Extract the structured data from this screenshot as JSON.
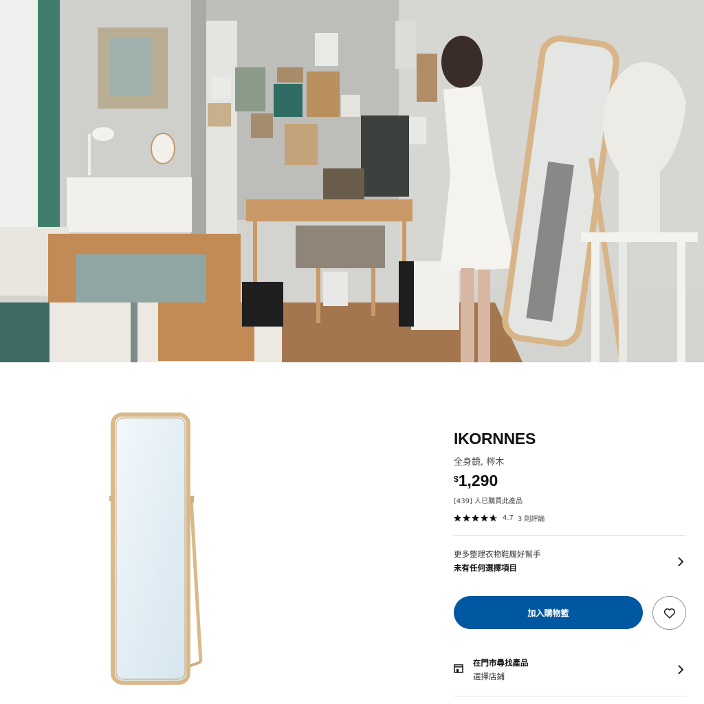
{
  "product": {
    "name": "IKORNNES",
    "description": "全身鏡, 梣木",
    "price_currency": "$",
    "price_amount": "1,290",
    "purchased_text": "[439] 人已購買此產品",
    "rating_value": "4.7",
    "rating_stars": 4.7,
    "rating_count": "3 則評論"
  },
  "options": {
    "title": "更多整理衣物鞋履好幫手",
    "selection": "未有任何選擇項目"
  },
  "actions": {
    "add_to_cart": "加入購物籃"
  },
  "store": {
    "title": "在門市尋找產品",
    "subtitle": "選擇店鋪"
  },
  "colors": {
    "primary_button": "#0058a3",
    "text": "#111111",
    "mirror_frame": "#d9b98a"
  },
  "icons": {
    "favorite": "heart-icon",
    "chevron": "chevron-right-icon",
    "store": "store-icon",
    "star": "star-icon"
  }
}
